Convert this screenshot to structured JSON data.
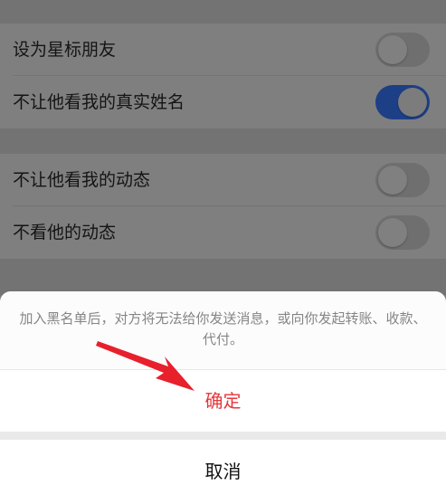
{
  "settings": {
    "group1": [
      {
        "label": "设为星标朋友",
        "toggle_on": false
      },
      {
        "label": "不让他看我的真实姓名",
        "toggle_on": true
      }
    ],
    "group2": [
      {
        "label": "不让他看我的动态",
        "toggle_on": false
      },
      {
        "label": "不看他的动态",
        "toggle_on": false
      }
    ]
  },
  "action_sheet": {
    "message": "加入黑名单后，对方将无法给你发送消息，或向你发起转账、收款、代付。",
    "confirm_label": "确定",
    "cancel_label": "取消"
  },
  "colors": {
    "toggle_on": "#1d3f86",
    "confirm_text": "#e5373b",
    "annotation_arrow": "#e8202c"
  },
  "annotation": {
    "icon": "red-arrow-icon"
  },
  "watermark": {
    "icon": "baidu-logo-icon"
  }
}
